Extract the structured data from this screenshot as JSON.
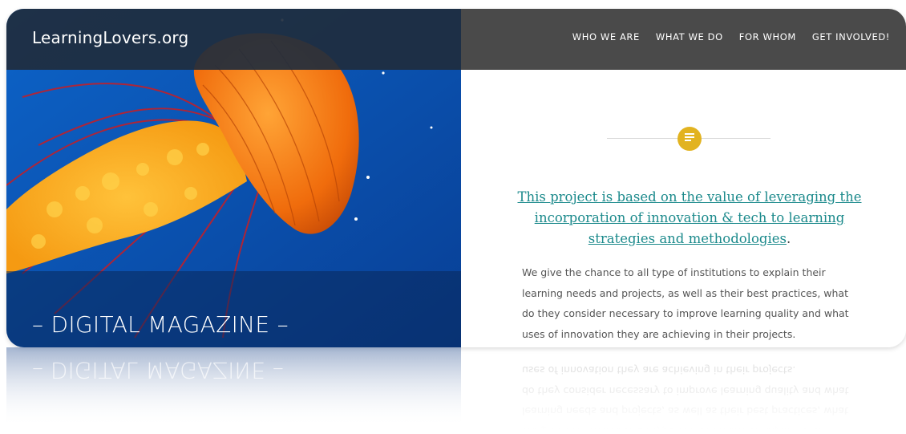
{
  "site": {
    "title": "LearningLovers.org"
  },
  "nav": {
    "items": [
      "WHO WE ARE",
      "WHAT WE DO",
      "FOR WHOM",
      "GET INVOLVED!"
    ]
  },
  "hero": {
    "caption": "– DIGITAL MAGAZINE –"
  },
  "content": {
    "icon": "document-icon",
    "headline_link": "This project is based on the value of leveraging the incorporation of innovation & tech to learning strategies and methodologies",
    "headline_tail": ".",
    "body": "We give the chance to all type of institutions to explain their learning needs and projects, as well as their best practices, what do they consider necessary to improve learning quality and what uses of innovation they are achieving in their projects."
  },
  "colors": {
    "header_left": "#1f2c3d",
    "header_right": "#4a4a4a",
    "accent_link": "#1c8a8c",
    "badge": "#e2b320",
    "ocean": "#0a57b8",
    "jellyfish": "#f07a12"
  }
}
